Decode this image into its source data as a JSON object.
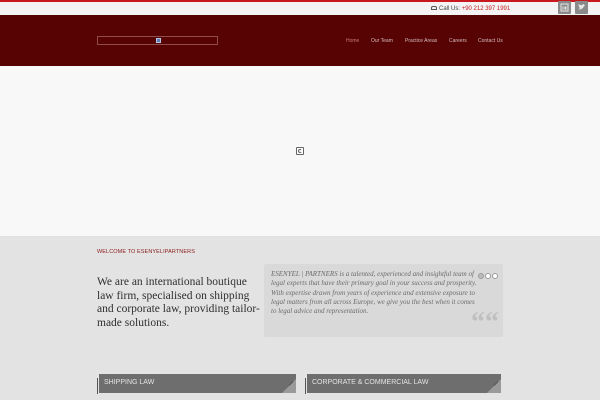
{
  "topbar": {
    "call_label": "Call Us:",
    "call_number": "+90 212 397 1991",
    "social": [
      {
        "name": "linkedin-icon"
      },
      {
        "name": "twitter-icon"
      }
    ]
  },
  "header": {
    "nav": [
      "Home",
      "Our Team",
      "Practice Areas",
      "Careers",
      "Contact Us"
    ]
  },
  "intro": {
    "welcome": "WELCOME TO ESENYELIPARTNERS",
    "headline": "We are an international boutique law firm, specialised on shipping and corporate law, providing tailor-made solutions.",
    "quote": "ESENYEL | PARTNERS is a talented, experienced and insightful team of legal experts that have their primary goal in your success and prosperity. With expertise drawn from years of experience and extensive exposure to legal matters from all across Europe, we give you the best when it comes to legal advice and representation.",
    "quote_mark": "““"
  },
  "practice": {
    "cards": [
      "SHIPPING LAW",
      "CORPORATE & COMMERCIAL LAW"
    ]
  },
  "colors": {
    "accent": "#c8191f",
    "header_bg": "#570303",
    "card_bg": "#6e6e6e"
  }
}
